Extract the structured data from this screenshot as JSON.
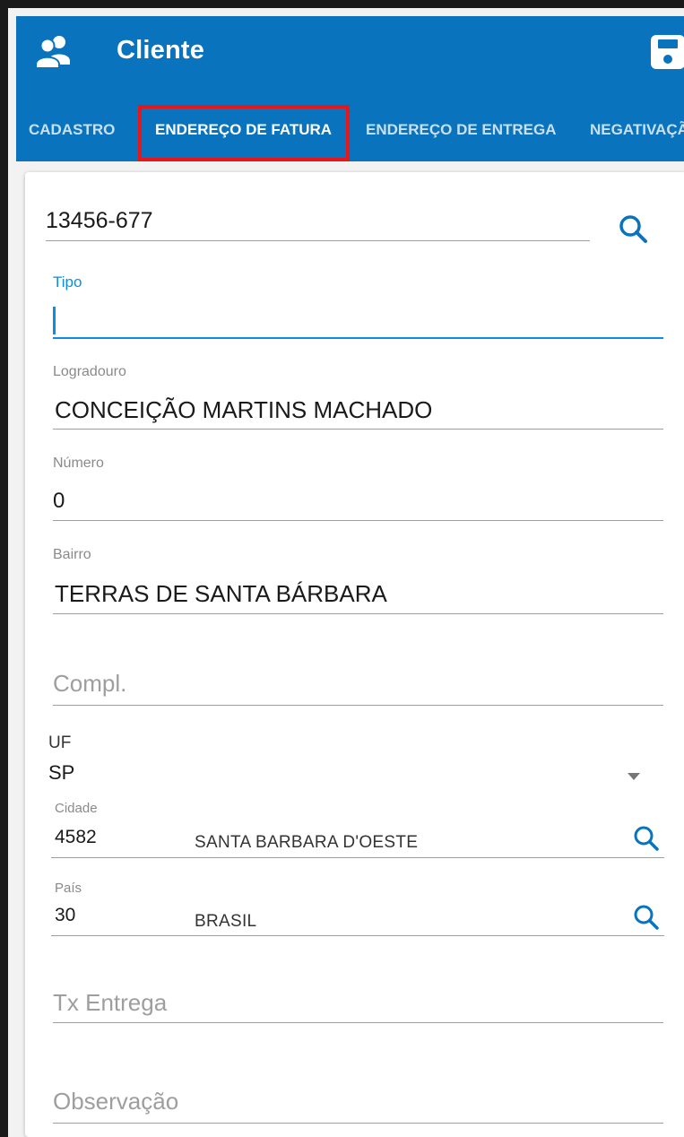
{
  "app": {
    "title": "Cliente",
    "accent_color": "#0a73bd",
    "icons": {
      "left": "users-icon",
      "right": "save-icon"
    }
  },
  "tabs": [
    {
      "label": "CADASTRO",
      "selected": false
    },
    {
      "label": "ENDEREÇO DE FATURA",
      "selected": true
    },
    {
      "label": "ENDEREÇO DE ENTREGA",
      "selected": false
    },
    {
      "label": "NEGATIVAÇÃ",
      "selected": false
    }
  ],
  "form": {
    "cep": {
      "value": "13456-677",
      "icon": "search-icon"
    },
    "tipo": {
      "label": "Tipo",
      "value": ""
    },
    "logradouro": {
      "label": "Logradouro",
      "value": "CONCEIÇÃO MARTINS MACHADO"
    },
    "numero": {
      "label": "Número",
      "value": "0"
    },
    "bairro": {
      "label": "Bairro",
      "value": "TERRAS DE SANTA BÁRBARA"
    },
    "compl": {
      "placeholder": "Compl.",
      "value": ""
    },
    "uf": {
      "label": "UF",
      "value": "SP",
      "icon": "caret-down-icon"
    },
    "cidade": {
      "label": "Cidade",
      "code": "4582",
      "name": "SANTA BARBARA D'OESTE",
      "icon": "search-icon"
    },
    "pais": {
      "label": "País",
      "code": "30",
      "name": "BRASIL",
      "icon": "search-icon"
    },
    "tx_entrega": {
      "placeholder": "Tx Entrega",
      "value": ""
    },
    "observacao": {
      "placeholder": "Observação",
      "value": ""
    }
  }
}
